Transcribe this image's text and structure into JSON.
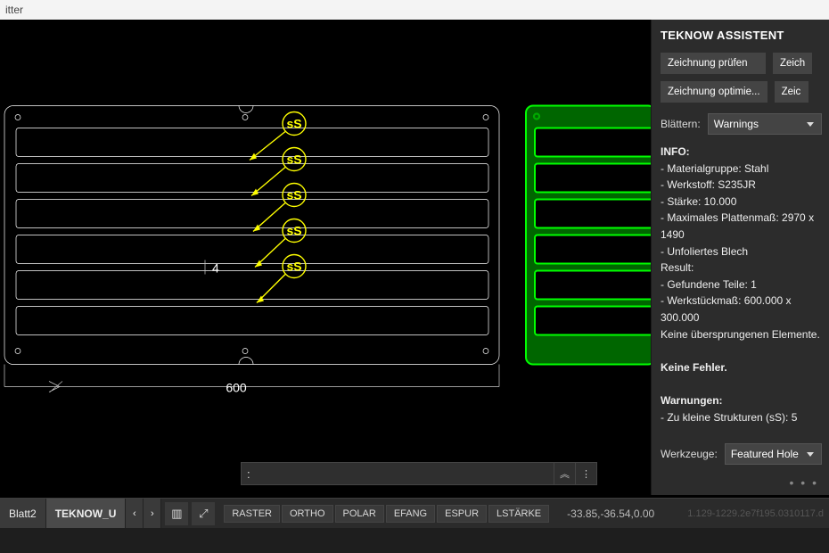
{
  "titlebar": {
    "left": "itter",
    "right": ""
  },
  "assistant": {
    "title": "TEKNOW ASSISTENT",
    "buttons": {
      "check": "Zeichnung prüfen",
      "check2": "Zeich",
      "optimize": "Zeichnung optimie...",
      "optimize2": "Zeic"
    },
    "scroll_label": "Blättern:",
    "scroll_select": "Warnings",
    "info_heading": "INFO:",
    "info_lines": [
      "- Materialgruppe: Stahl",
      "- Werkstoff: S235JR",
      "- Stärke: 10.000",
      "- Maximales Plattenmaß: 2970 x 1490",
      "- Unfoliertes Blech"
    ],
    "result_heading": "Result:",
    "result_lines": [
      "- Gefundene Teile: 1",
      "- Werkstückmaß: 600.000 x 300.000",
      "Keine übersprungenen Elemente."
    ],
    "errors": "Keine Fehler.",
    "warnings_heading": "Warnungen:",
    "warnings_lines": [
      "- Zu kleine Strukturen (sS): 5"
    ],
    "tools_label": "Werkzeuge:",
    "tools_select": "Featured Hole"
  },
  "cmdbar": {
    "prompt": ":"
  },
  "bottom": {
    "tabs": [
      "Blatt2",
      "TEKNOW_U"
    ],
    "nav_prev": "‹",
    "nav_next": "›",
    "osnaps": [
      "RASTER",
      "ORTHO",
      "POLAR",
      "EFANG",
      "ESPUR",
      "LSTÄRKE"
    ],
    "coords": "-33.85,-36.54,0.00",
    "rightstatus": "1.129-1229.2e7f195.0310117.d"
  },
  "drawing": {
    "dim_width": "600",
    "gap_dim": "4",
    "ss_tags": [
      "sS",
      "sS",
      "sS",
      "sS",
      "sS"
    ]
  }
}
